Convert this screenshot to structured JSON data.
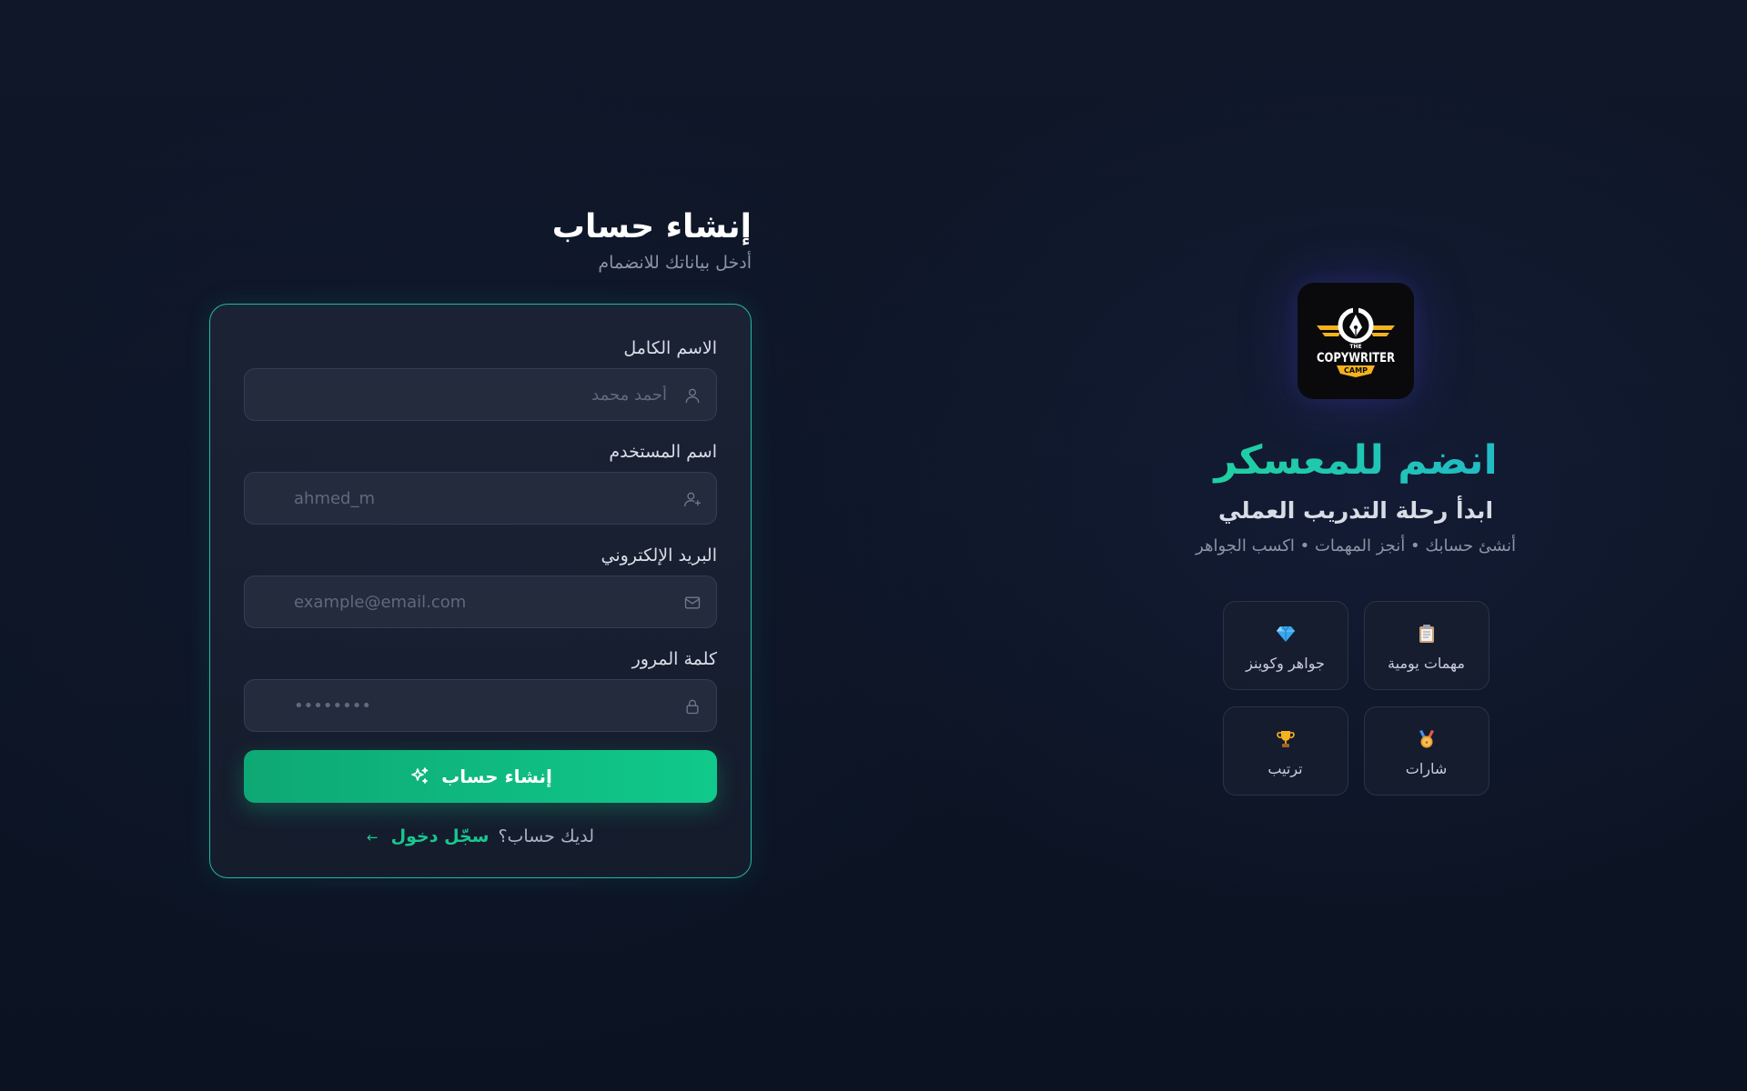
{
  "form": {
    "title": "إنشاء حساب",
    "subtitle": "أدخل بياناتك للانضمام",
    "fields": [
      {
        "label": "الاسم الكامل",
        "placeholder": "أحمد محمد",
        "icon": "user-icon"
      },
      {
        "label": "اسم المستخدم",
        "placeholder": "ahmed_m",
        "icon": "user-plus-icon"
      },
      {
        "label": "البريد الإلكتروني",
        "placeholder": "example@email.com",
        "icon": "mail-icon"
      },
      {
        "label": "كلمة المرور",
        "placeholder": "••••••••",
        "icon": "lock-icon"
      }
    ],
    "submit_label": "إنشاء حساب",
    "submit_icon": "sparkles-icon",
    "login_prompt": "لديك حساب؟",
    "login_link": "سجّل دخول",
    "login_arrow": "←"
  },
  "promo": {
    "logo": {
      "line_top": "THE",
      "line_main": "COPYWRITER",
      "line_bottom": "CAMP"
    },
    "title": "انضم للمعسكر",
    "subtitle": "ابدأ رحلة التدريب العملي",
    "tagline": "أنشئ حسابك • أنجز المهمات • اكسب الجواهر",
    "features": [
      {
        "label": "مهمات يومية",
        "icon": "clipboard-icon"
      },
      {
        "label": "جواهر وكوينز",
        "icon": "gem-icon"
      },
      {
        "label": "شارات",
        "icon": "medal-icon"
      },
      {
        "label": "ترتيب",
        "icon": "trophy-icon"
      }
    ]
  },
  "colors": {
    "accent_green": "#10c98a",
    "accent_teal": "#1fb7a3",
    "background": "#0d1526"
  }
}
